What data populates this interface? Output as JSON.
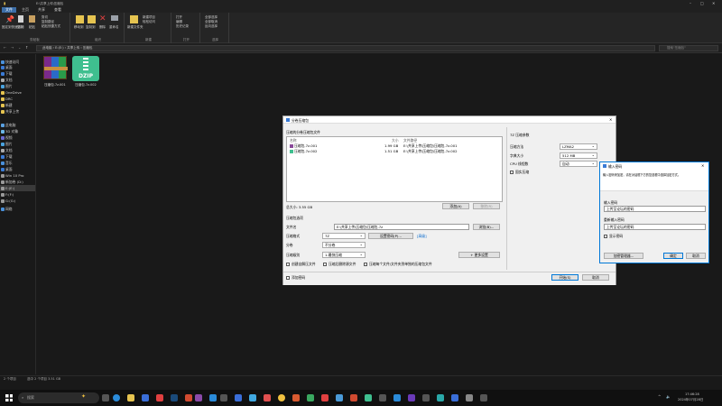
{
  "window": {
    "title": "E:\\共享上传\\压缩包"
  },
  "ribbon": {
    "tabs": [
      "文件",
      "主页",
      "共享",
      "查看"
    ],
    "clipboard": {
      "group": "剪贴板",
      "pin": "固定到快速访问",
      "copy": "复制",
      "paste": "粘贴",
      "cut": "剪切",
      "copy_path": "复制路径",
      "paste_shortcut": "粘贴快捷方式"
    },
    "organize": {
      "group": "组织",
      "move_to": "移动到",
      "copy_to": "复制到",
      "delete": "删除",
      "rename": "重命名"
    },
    "new": {
      "group": "新建",
      "new_folder": "新建文件夹",
      "new_item": "新建项目",
      "easy_access": "轻松访问"
    },
    "open": {
      "group": "打开",
      "properties": "属性",
      "open": "打开",
      "edit": "编辑",
      "history": "历史记录"
    },
    "select": {
      "group": "选择",
      "select_all": "全部选择",
      "select_none": "全部取消",
      "invert": "反向选择"
    }
  },
  "address": {
    "path": [
      "此电脑",
      "E:(E:)",
      "共享上传",
      "压缩包"
    ],
    "search_placeholder": "搜索\"压缩包\""
  },
  "nav": {
    "items": [
      "快速访问",
      "桌面",
      "下载",
      "文档",
      "图片",
      "OneDrive",
      "DRC",
      "新建",
      "共享上传",
      "此电脑",
      "3D 对象",
      "视频",
      "图片",
      "文档",
      "下载",
      "音乐",
      "桌面",
      "Win 10 Pro",
      "新加卷 (D:)",
      "E:(E:)",
      "F:(F:)",
      "G:(G:)",
      "网络"
    ]
  },
  "files": [
    {
      "name": "压缩包.7z.001",
      "icon": "winrar-icon"
    },
    {
      "name": "压缩包.7z.002",
      "icon": "dzip-icon",
      "badge": "DZIP"
    }
  ],
  "statusbar": {
    "count": "2 个项目",
    "selected": "选中 2 个项目 3.51 GB"
  },
  "dialog": {
    "title": "分卷压缩包",
    "section_files": "压缩的分卷压缩包文件",
    "cols": [
      "名称",
      "大小",
      "文件路径"
    ],
    "rows": [
      {
        "name": "压缩包.7z.001",
        "size": "1.99 GB",
        "path": "E:\\共享上传\\压缩包\\压缩包.7z.001"
      },
      {
        "name": "压缩包.7z.002",
        "size": "1.51 GB",
        "path": "E:\\共享上传\\压缩包\\压缩包.7z.002"
      }
    ],
    "total": "总大小: 3.55 GB",
    "btn_add": "添加(A)",
    "btn_remove": "移除(R)",
    "section_output": "压缩包选项",
    "label_name": "文件名",
    "name_value": "E:\\共享上传\\压缩包\\压缩包.7z",
    "btn_browse": "浏览(B)...",
    "label_format": "压缩格式",
    "format_value": "7Z",
    "label_password": "设置密码(P)...",
    "link_pw": "[高级]",
    "label_level": "分卷",
    "level_value": "不分卷",
    "label_method": "压缩级别",
    "method_value": "1-最快压缩",
    "btn_more": "+ 更多设置",
    "chk_fast": "创建自解压文件",
    "chk_delete": "压缩后删除源文件",
    "chk_split": "压缩每个文件/文件夹到单独的压缩包文件",
    "footer_check": "添加密码",
    "btn_ok": "开始(S)",
    "btn_cancel": "取消",
    "section_right": "7Z 压缩参数",
    "r_label1": "压缩方法",
    "r_val1": "LZMA2",
    "r_label2": "字典大小",
    "r_val2": "512 MB",
    "r_label3": "CPU 线程数",
    "r_val3": "自动",
    "r_check": "固实压缩"
  },
  "dialog2": {
    "title": "输入密码",
    "desc": "输入密码来加密，请在对话框下方的复选框中选择加密方式。",
    "label_pw": "输入密码",
    "pw_value": "上传至论坛的密码",
    "label_confirm": "重新输入密码",
    "confirm_value": "上传至论坛的密码",
    "show_pw": "显示密码",
    "btn_manage": "加密管理器...",
    "btn_ok": "确定",
    "btn_cancel": "取消"
  },
  "taskbar": {
    "search": "搜索",
    "time": "17:46:28",
    "date": "2024年07月28日"
  }
}
